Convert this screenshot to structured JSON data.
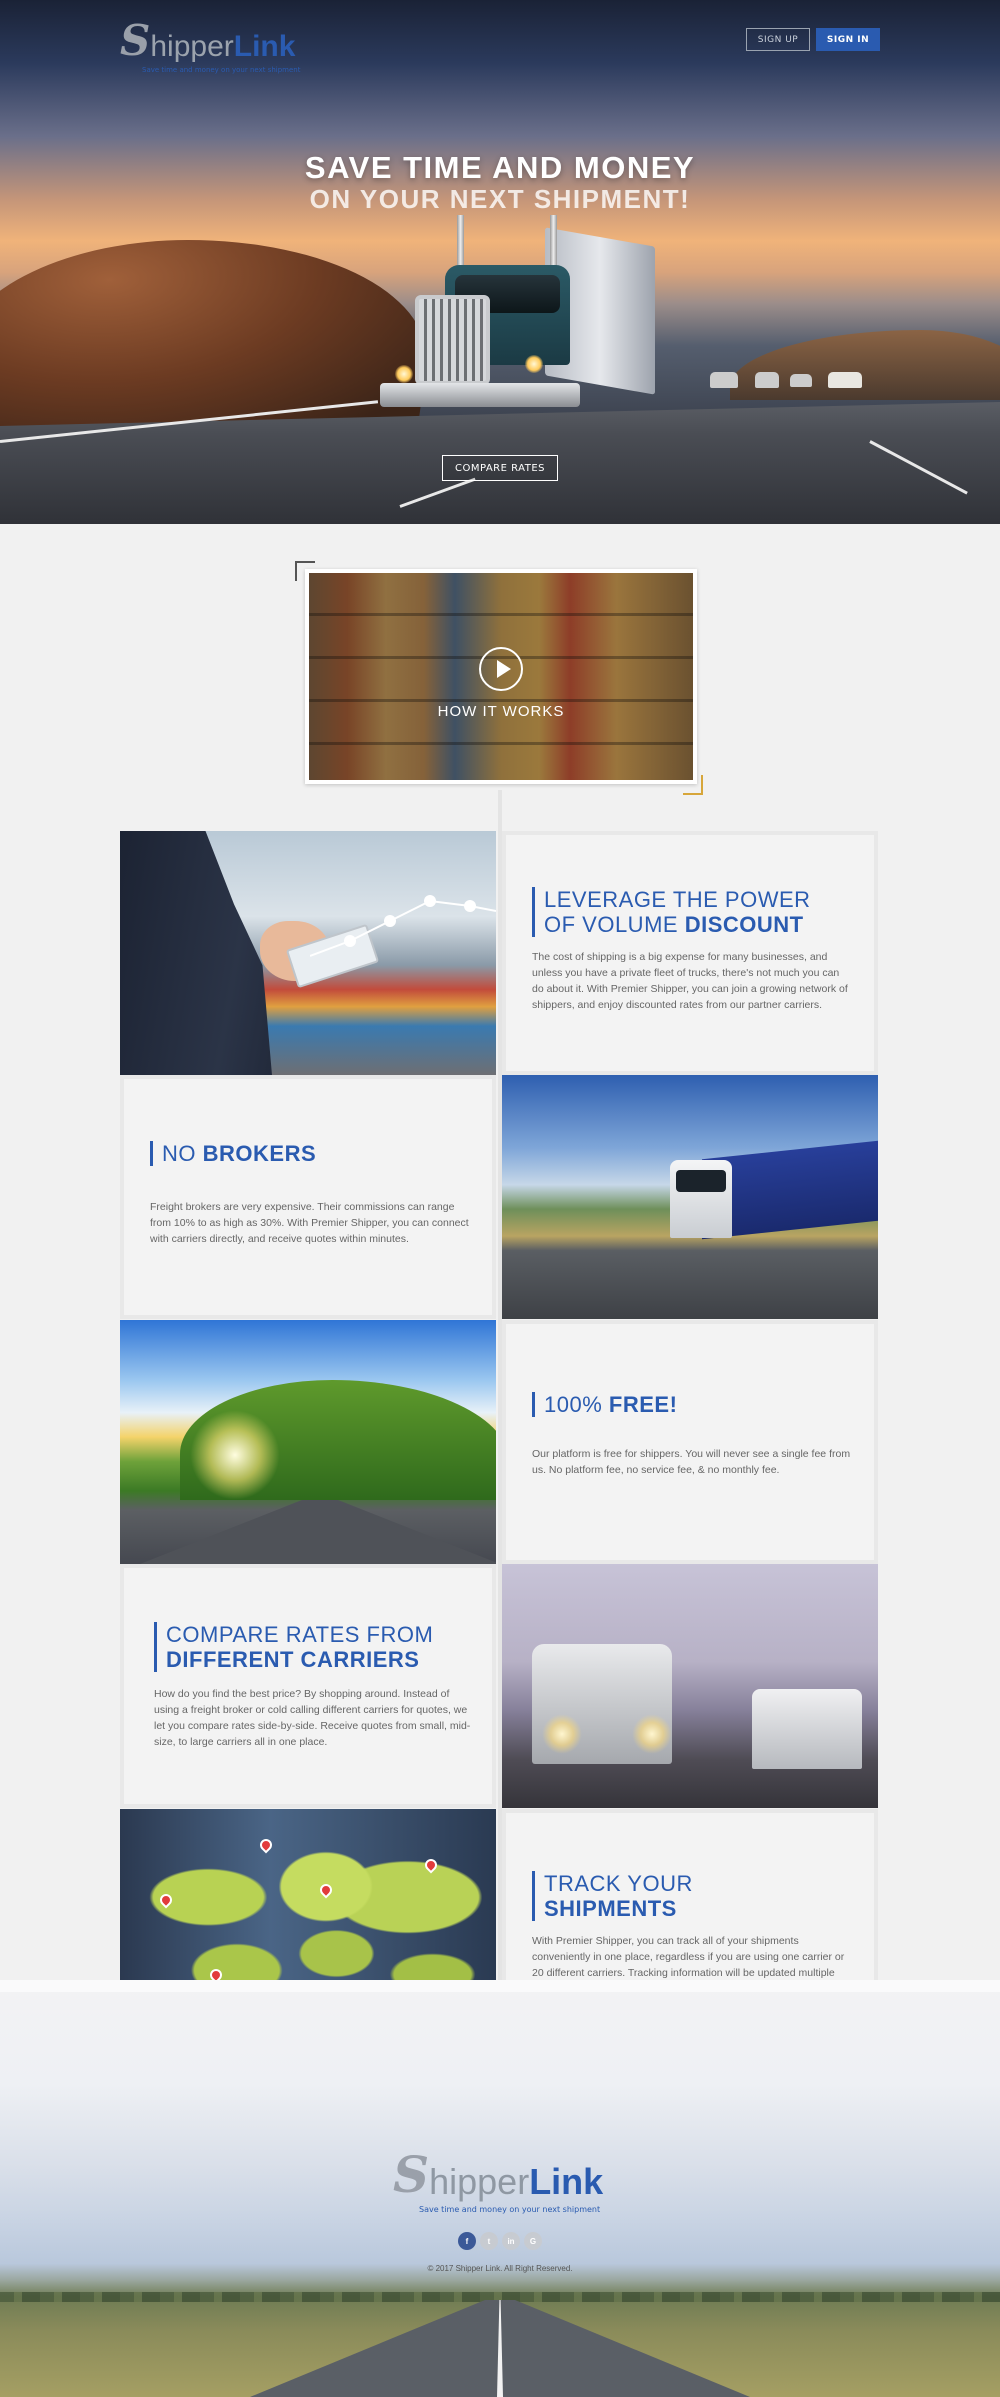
{
  "header": {
    "logo_s": "S",
    "logo_shipper": "hipper",
    "logo_link": "Link",
    "logo_tagline": "Save time and money on your next shipment",
    "signup_label": "SIGN UP",
    "signin_label": "SIGN IN"
  },
  "hero": {
    "title_line1": "SAVE TIME AND MONEY",
    "title_line2": "ON YOUR NEXT SHIPMENT!",
    "cta_label": "COMPARE RATES"
  },
  "video": {
    "label": "HOW IT WORKS",
    "icon": "play-icon"
  },
  "features": [
    {
      "title_light": "LEVERAGE THE POWER",
      "title_light2": "OF VOLUME ",
      "title_bold": "DISCOUNT",
      "body": "The cost of shipping is a big expense for many businesses, and unless you have a private fleet of trucks, there's not much you can do about it. With Premier Shipper, you can join a growing network of shippers, and enjoy discounted rates from our partner carriers."
    },
    {
      "title_light": "NO ",
      "title_bold": "BROKERS",
      "body": "Freight brokers are very expensive. Their commissions can range from 10% to as high as 30%. With Premier Shipper, you can connect with carriers directly, and receive quotes within minutes."
    },
    {
      "title_light": "100% ",
      "title_bold": "FREE!",
      "body": "Our platform is free for shippers. You will never see a single fee from us. No platform fee, no service fee, & no monthly fee."
    },
    {
      "title_light": "COMPARE RATES FROM",
      "title_bold": "DIFFERENT CARRIERS",
      "body": "How do you find the best price? By shopping around. Instead of using a freight broker or cold calling different carriers for quotes, we let you compare rates side-by-side. Receive quotes from small, mid-size, to large carriers all in one place."
    },
    {
      "title_light": "TRACK YOUR",
      "title_bold": "SHIPMENTS",
      "body": "With Premier Shipper, you can track all of your shipments conveniently in one place, regardless if you are using one carrier or 20 different carriers. Tracking information will be updated multiple times per day"
    }
  ],
  "footer": {
    "logo_s": "S",
    "logo_shipper": "hipper",
    "logo_link": "Link",
    "tagline": "Save time and money on your next shipment",
    "social": [
      {
        "icon": "facebook-icon",
        "glyph": "f",
        "color": "#3b5998"
      },
      {
        "icon": "twitter-icon",
        "glyph": "t",
        "color": "#c7cbd1"
      },
      {
        "icon": "linkedin-icon",
        "glyph": "in",
        "color": "#c7cbd1"
      },
      {
        "icon": "google-plus-icon",
        "glyph": "G",
        "color": "#c7cbd1"
      }
    ],
    "copyright": "© 2017 Shipper Link. All Right Reserved."
  },
  "colors": {
    "brand_blue": "#2a5bb0",
    "accent_gold": "#d7a63a"
  }
}
